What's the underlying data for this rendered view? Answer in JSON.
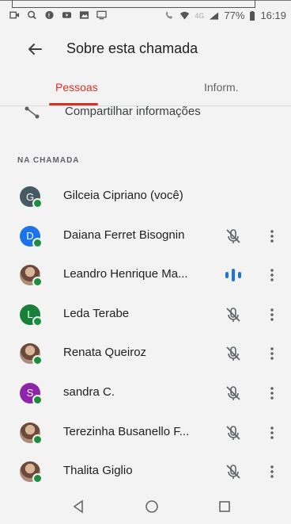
{
  "status_bar": {
    "battery": "77%",
    "time": "16:19",
    "net_label": "4G"
  },
  "header": {
    "title": "Sobre esta chamada"
  },
  "tabs": [
    {
      "label": "Pessoas",
      "active": true
    },
    {
      "label": "Inform.",
      "active": false
    }
  ],
  "share": {
    "label": "Compartilhar informações"
  },
  "section": {
    "label": "NA CHAMADA"
  },
  "participants": [
    {
      "name": "Gilceia Cipriano (você)",
      "avatar_letter": "G",
      "avatar_color": "#455a64",
      "muted": false,
      "speaking": false,
      "self": true
    },
    {
      "name": "Daiana Ferret Bisognin",
      "avatar_letter": "D",
      "avatar_color": "#1a73e8",
      "muted": true,
      "speaking": false,
      "self": false
    },
    {
      "name": "Leandro Henrique Ma...",
      "avatar_letter": "",
      "avatar_color": "",
      "muted": false,
      "speaking": true,
      "self": false
    },
    {
      "name": "Leda Terabe",
      "avatar_letter": "L",
      "avatar_color": "#188038",
      "muted": true,
      "speaking": false,
      "self": false
    },
    {
      "name": "Renata Queiroz",
      "avatar_letter": "",
      "avatar_color": "",
      "muted": true,
      "speaking": false,
      "self": false
    },
    {
      "name": "sandra C.",
      "avatar_letter": "S",
      "avatar_color": "#8e24aa",
      "muted": true,
      "speaking": false,
      "self": false
    },
    {
      "name": "Terezinha Busanello F...",
      "avatar_letter": "",
      "avatar_color": "",
      "muted": true,
      "speaking": false,
      "self": false
    },
    {
      "name": "Thalita Giglio",
      "avatar_letter": "",
      "avatar_color": "",
      "muted": true,
      "speaking": false,
      "self": false
    }
  ],
  "colors": {
    "accent": "#d93025",
    "speaking": "#1a73e8",
    "online": "#1e8e3e"
  },
  "icons": {
    "back": "arrow-left-icon",
    "share": "share-icon",
    "mic_off": "mic-off-icon",
    "more": "more-vert-icon",
    "nav_back": "triangle-back-icon",
    "nav_home": "circle-home-icon",
    "nav_recents": "square-recents-icon"
  }
}
